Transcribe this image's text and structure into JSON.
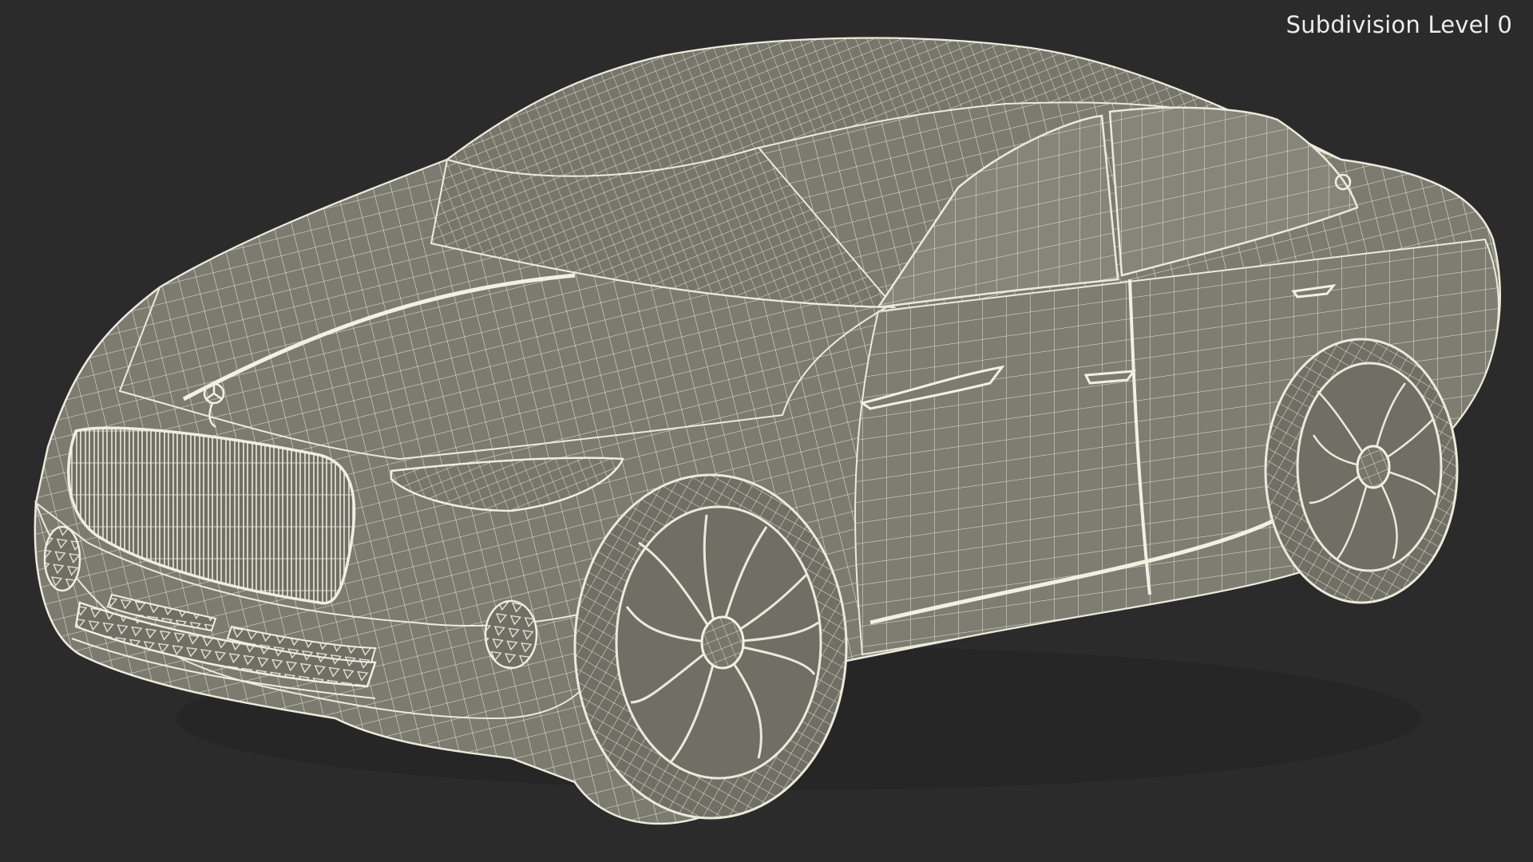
{
  "viewport": {
    "subdivision_label": "Subdivision Level 0",
    "background_color": "#2b2b2b",
    "surface_color": "#7a7a6e",
    "wire_color": "#e8e6d6"
  },
  "model": {
    "subject": "sedan-wireframe",
    "icon": "car-wireframe"
  }
}
